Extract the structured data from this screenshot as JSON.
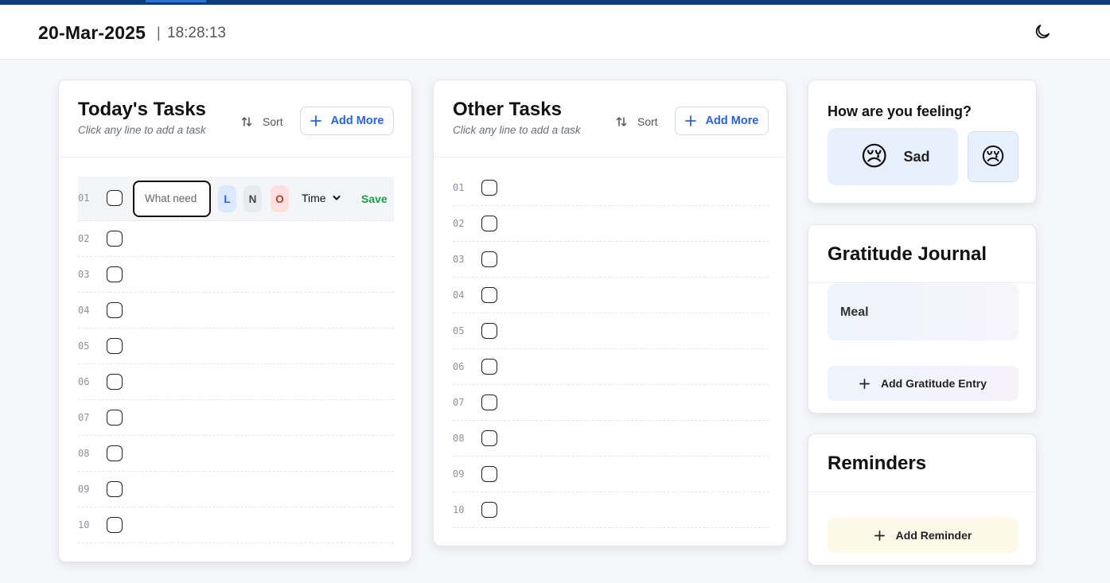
{
  "header": {
    "date": "20-Mar-2025",
    "separator": "|",
    "time": "18:28:13",
    "theme_icon": "moon-icon"
  },
  "colors": {
    "accent_bar": "#0d3d7a",
    "primary": "#2563eb",
    "save": "#16a34a",
    "background": "#f4f6f9"
  },
  "todays_tasks": {
    "title": "Today's Tasks",
    "subtitle": "Click any line to add a task",
    "sort_label": "Sort",
    "add_label": "Add More",
    "editing_row": {
      "number": "01",
      "placeholder": "What need",
      "priority_l": "L",
      "priority_n": "N",
      "priority_o": "O",
      "time_label": "Time",
      "save_label": "Save"
    },
    "rows": [
      "02",
      "03",
      "04",
      "05",
      "06",
      "07",
      "08",
      "09",
      "10"
    ]
  },
  "other_tasks": {
    "title": "Other Tasks",
    "subtitle": "Click any line to add a task",
    "sort_label": "Sort",
    "add_label": "Add More",
    "rows": [
      "01",
      "02",
      "03",
      "04",
      "05",
      "06",
      "07",
      "08",
      "09",
      "10"
    ]
  },
  "mood": {
    "title": "How are you feeling?",
    "selected_emoji": "😢",
    "selected_label": "Sad",
    "alt_emoji": "😢"
  },
  "gratitude": {
    "title": "Gratitude Journal",
    "entries": [
      "Meal"
    ],
    "add_label": "Add Gratitude Entry"
  },
  "reminders": {
    "title": "Reminders",
    "add_label": "Add Reminder"
  }
}
